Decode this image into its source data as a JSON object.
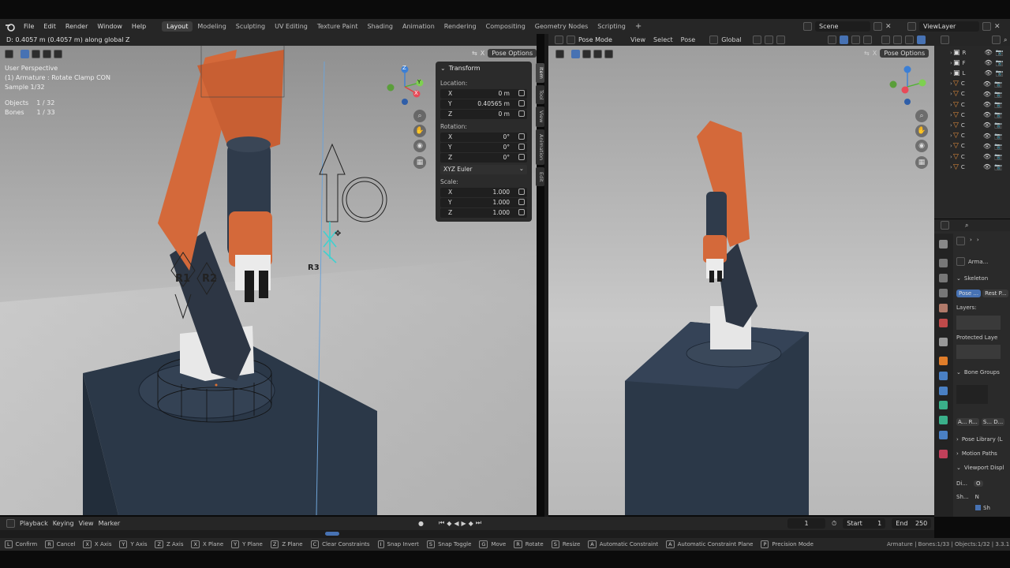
{
  "menu": {
    "items": [
      "File",
      "Edit",
      "Render",
      "Window",
      "Help"
    ],
    "workspaces": [
      "Layout",
      "Modeling",
      "Sculpting",
      "UV Editing",
      "Texture Paint",
      "Shading",
      "Animation",
      "Rendering",
      "Compositing",
      "Geometry Nodes",
      "Scripting"
    ],
    "active_workspace": "Layout",
    "scene": "Scene",
    "view_layer": "ViewLayer"
  },
  "left_viewport": {
    "header_status": "D: 0.4057 m (0.4057 m) along global Z",
    "pose_options": "Pose Options",
    "overlay_text": {
      "perspective": "User Perspective",
      "object_name": "(1) Armature : Rotate Clamp CON",
      "sample": "Sample 1/32",
      "objects_label": "Objects",
      "objects_value": "1 / 32",
      "bones_label": "Bones",
      "bones_value": "1 / 33"
    },
    "bone_labels": [
      "R1",
      "R2",
      "R3"
    ]
  },
  "transform_panel": {
    "title": "Transform",
    "location_label": "Location:",
    "location": [
      {
        "axis": "X",
        "value": "0 m"
      },
      {
        "axis": "Y",
        "value": "0.40565 m"
      },
      {
        "axis": "Z",
        "value": "0 m"
      }
    ],
    "rotation_label": "Rotation:",
    "rotation": [
      {
        "axis": "X",
        "value": "0°"
      },
      {
        "axis": "Y",
        "value": "0°"
      },
      {
        "axis": "Z",
        "value": "0°"
      }
    ],
    "rotation_mode": "XYZ Euler",
    "scale_label": "Scale:",
    "scale": [
      {
        "axis": "X",
        "value": "1.000"
      },
      {
        "axis": "Y",
        "value": "1.000"
      },
      {
        "axis": "Z",
        "value": "1.000"
      }
    ],
    "side_tabs": [
      "Item",
      "Tool",
      "View",
      "Animation",
      "Edit"
    ]
  },
  "right_viewport": {
    "mode": "Pose Mode",
    "menus": [
      "View",
      "Select",
      "Pose"
    ],
    "transform_orientation": "Global",
    "pose_options": "Pose Options"
  },
  "gizmo": {
    "x": "X",
    "y": "Y",
    "z": "Z"
  },
  "outliner": {
    "rows": [
      "R",
      "F",
      "L",
      "C",
      "C",
      "C",
      "C",
      "C",
      "C",
      "C",
      "C",
      "C"
    ]
  },
  "properties": {
    "data_name": "Arma...",
    "skeleton": "Skeleton",
    "pose_btn": "Pose ...",
    "rest_btn": "Rest P...",
    "layers": "Layers:",
    "protected": "Protected Laye",
    "bone_groups": "Bone Groups",
    "bg_btn1": "A... R...",
    "bg_btn2": "S... D...",
    "pose_library": "Pose Library (L",
    "motion_paths": "Motion Paths",
    "viewport_display": "Viewport Displ",
    "disp_label": "Di...",
    "disp_value": "O",
    "show_label": "Sh...",
    "opt1": "N",
    "opt2": "Sh",
    "opt3": "Gr",
    "opt4": "L..."
  },
  "timeline": {
    "menus": [
      "Playback",
      "Keying",
      "View",
      "Marker"
    ],
    "current_frame": "1",
    "start_label": "Start",
    "start": "1",
    "end_label": "End",
    "end": "250"
  },
  "status_bar": {
    "items": [
      {
        "key": "L",
        "label": "Confirm"
      },
      {
        "key": "R",
        "label": "Cancel"
      },
      {
        "key": "X",
        "label": "X Axis"
      },
      {
        "key": "Y",
        "label": "Y Axis"
      },
      {
        "key": "Z",
        "label": "Z Axis"
      },
      {
        "key": "X",
        "label": "X Plane"
      },
      {
        "key": "Y",
        "label": "Y Plane"
      },
      {
        "key": "Z",
        "label": "Z Plane"
      },
      {
        "key": "C",
        "label": "Clear Constraints"
      },
      {
        "key": "I",
        "label": "Snap Invert"
      },
      {
        "key": "S",
        "label": "Snap Toggle"
      },
      {
        "key": "G",
        "label": "Move"
      },
      {
        "key": "R",
        "label": "Rotate"
      },
      {
        "key": "S",
        "label": "Resize"
      },
      {
        "key": "A",
        "label": "Automatic Constraint"
      },
      {
        "key": "A",
        "label": "Automatic Constraint Plane"
      },
      {
        "key": "P",
        "label": "Precision Mode"
      }
    ],
    "info": "Armature | Bones:1/33 | Objects:1/32 | 3.3.1"
  },
  "colors": {
    "arm_orange": "#d4693a",
    "base_navy": "#2b3848",
    "accent_blue": "#4772b3",
    "bg_panel": "#262626"
  }
}
